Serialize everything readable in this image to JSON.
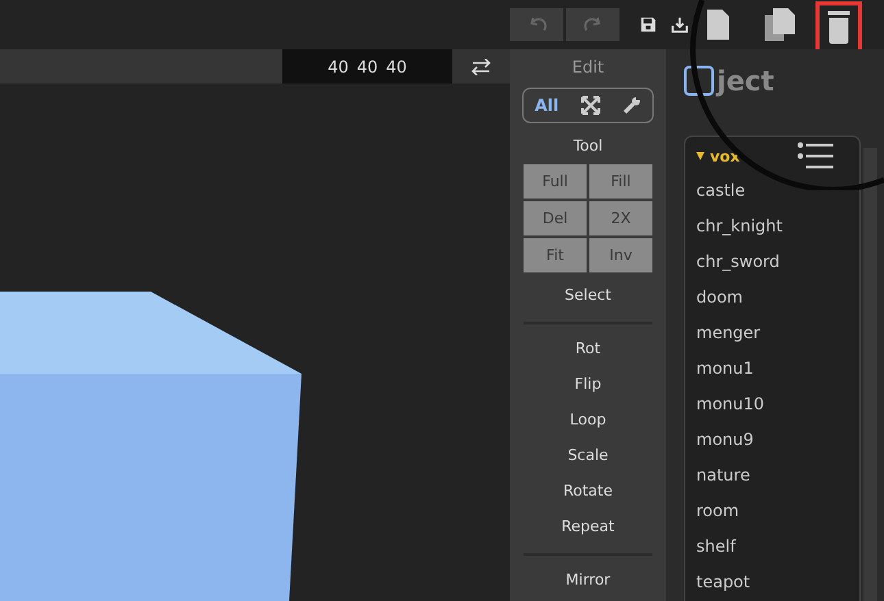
{
  "toolbar": {
    "icons": [
      {
        "kind": "undo",
        "selected": false
      },
      {
        "kind": "redo",
        "selected": false
      },
      {
        "kind": "save",
        "selected": false
      },
      {
        "kind": "download",
        "selected": false
      },
      {
        "kind": "new-file",
        "selected": false
      },
      {
        "kind": "copy",
        "selected": false
      },
      {
        "kind": "trash",
        "selected": true
      }
    ]
  },
  "dimensions": {
    "values": [
      "40",
      "40",
      "40"
    ]
  },
  "edit_panel": {
    "title": "Edit",
    "modes": [
      {
        "kind": "text",
        "label": "All",
        "selected": true
      },
      {
        "kind": "expand",
        "selected": false
      },
      {
        "kind": "wrench",
        "selected": false
      }
    ],
    "tool_title": "Tool",
    "tool_buttons": [
      "Full",
      "Fill",
      "Del",
      "2X",
      "Fit",
      "Inv"
    ],
    "select_label": "Select",
    "actions": [
      "Rot",
      "Flip",
      "Loop",
      "Scale",
      "Rotate",
      "Repeat"
    ],
    "more_actions": [
      "Mirror"
    ]
  },
  "object_panel": {
    "title": "ject",
    "folder": {
      "label": "vox",
      "expanded": true
    },
    "items": [
      "castle",
      "chr_knight",
      "chr_sword",
      "doom",
      "menger",
      "monu1",
      "monu10",
      "monu9",
      "nature",
      "room",
      "shelf",
      "teapot"
    ]
  }
}
